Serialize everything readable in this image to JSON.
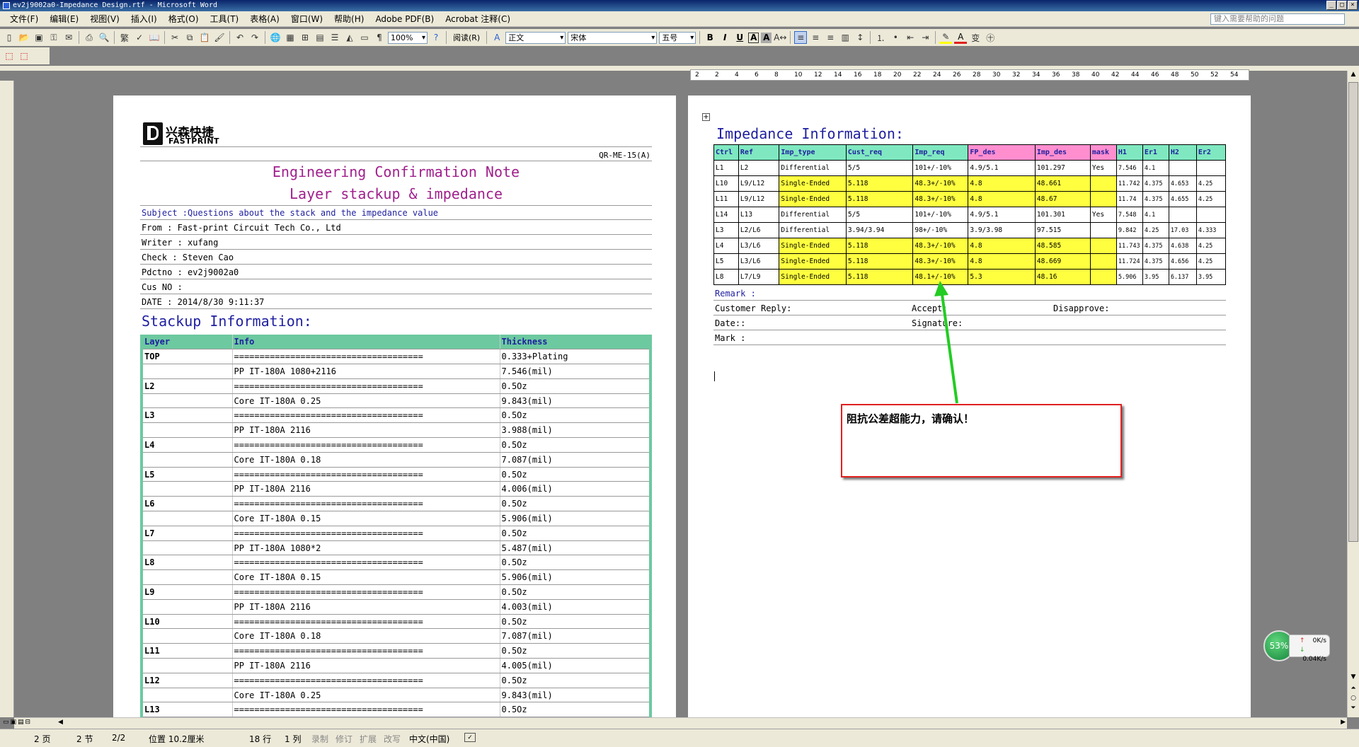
{
  "window": {
    "title": "ev2j9002a0-Impedance Design.rtf - Microsoft Word"
  },
  "menu": [
    "文件(F)",
    "编辑(E)",
    "视图(V)",
    "插入(I)",
    "格式(O)",
    "工具(T)",
    "表格(A)",
    "窗口(W)",
    "帮助(H)",
    "Adobe PDF(B)",
    "Acrobat 注释(C)"
  ],
  "help_placeholder": "键入需要帮助的问题",
  "toolbar": {
    "zoom": "100%",
    "read_label": "阅读(R)",
    "style": "正文",
    "font": "宋体",
    "size": "五号"
  },
  "ruler_ticks": [
    "2",
    "2",
    "4",
    "6",
    "8",
    "10",
    "12",
    "14",
    "16",
    "18",
    "20",
    "22",
    "24",
    "26",
    "28",
    "30",
    "32",
    "34",
    "36",
    "38",
    "40",
    "42",
    "44",
    "46",
    "48",
    "50",
    "52",
    "54"
  ],
  "page1": {
    "logo_cn": "兴森快捷",
    "logo_en": "FASTPRINT",
    "doc_code": "QR-ME-15(A)",
    "title1": "Engineering Confirmation Note",
    "title2": "Layer stackup & impedance",
    "subject": "Subject :Questions about the stack and the impedance value",
    "from": "From    : Fast-print Circuit Tech Co., Ltd",
    "writer": "Writer  : xufang",
    "check": "Check   : Steven Cao",
    "pdctno": "Pdctno  : ev2j9002a0",
    "cusno": "Cus NO  : ",
    "date": "DATE    : 2014/8/30 9:11:37",
    "stackup_heading": "Stackup Information:",
    "stack_headers": [
      "Layer",
      "Info",
      "Thickness"
    ],
    "stack_rows": [
      [
        "TOP",
        "=====================================",
        "0.333+Plating"
      ],
      [
        "",
        "PP    IT-180A    1080+2116",
        "7.546(mil)"
      ],
      [
        "L2",
        "=====================================",
        "0.5Oz"
      ],
      [
        "",
        "Core     IT-180A    0.25",
        "9.843(mil)"
      ],
      [
        "L3",
        "=====================================",
        "0.5Oz"
      ],
      [
        "",
        "PP    IT-180A    2116",
        "3.988(mil)"
      ],
      [
        "L4",
        "=====================================",
        "0.5Oz"
      ],
      [
        "",
        "Core     IT-180A    0.18",
        "7.087(mil)"
      ],
      [
        "L5",
        "=====================================",
        "0.5Oz"
      ],
      [
        "",
        "PP    IT-180A    2116",
        "4.006(mil)"
      ],
      [
        "L6",
        "=====================================",
        "0.5Oz"
      ],
      [
        "",
        "Core     IT-180A    0.15",
        "5.906(mil)"
      ],
      [
        "L7",
        "=====================================",
        "0.5Oz"
      ],
      [
        "",
        "PP    IT-180A    1080*2",
        "5.487(mil)"
      ],
      [
        "L8",
        "=====================================",
        "0.5Oz"
      ],
      [
        "",
        "Core     IT-180A    0.15",
        "5.906(mil)"
      ],
      [
        "L9",
        "=====================================",
        "0.5Oz"
      ],
      [
        "",
        "PP    IT-180A    2116",
        "4.003(mil)"
      ],
      [
        "L10",
        "=====================================",
        "0.5Oz"
      ],
      [
        "",
        "Core     IT-180A    0.18",
        "7.087(mil)"
      ],
      [
        "L11",
        "=====================================",
        "0.5Oz"
      ],
      [
        "",
        "PP    IT-180A    2116",
        "4.005(mil)"
      ],
      [
        "L12",
        "=====================================",
        "0.5Oz"
      ],
      [
        "",
        "Core     IT-180A    0.25",
        "9.843(mil)"
      ],
      [
        "L13",
        "=====================================",
        "0.5Oz"
      ]
    ]
  },
  "page2": {
    "impedance_heading": "Impedance Information:",
    "imp_headers": [
      "Ctrl",
      "Ref",
      "Imp_type",
      "Cust_req",
      "Imp_req",
      "FP_des",
      "Imp_des",
      "mask",
      "H1",
      "Er1",
      "H2",
      "Er2"
    ],
    "imp_rows": [
      {
        "cells": [
          "L1",
          "L2",
          "Differential",
          "5/5",
          "101+/-10%",
          "4.9/5.1",
          "101.297",
          "Yes",
          "7.546",
          "4.1",
          "",
          ""
        ],
        "highlight": false
      },
      {
        "cells": [
          "L10",
          "L9/L12",
          "Single-Ended",
          "5.118",
          "48.3+/-10%",
          "4.8",
          "48.661",
          "",
          "11.742",
          "4.375",
          "4.653",
          "4.25"
        ],
        "highlight": true
      },
      {
        "cells": [
          "L11",
          "L9/L12",
          "Single-Ended",
          "5.118",
          "48.3+/-10%",
          "4.8",
          "48.67",
          "",
          "11.74",
          "4.375",
          "4.655",
          "4.25"
        ],
        "highlight": true
      },
      {
        "cells": [
          "L14",
          "L13",
          "Differential",
          "5/5",
          "101+/-10%",
          "4.9/5.1",
          "101.301",
          "Yes",
          "7.548",
          "4.1",
          "",
          ""
        ],
        "highlight": false
      },
      {
        "cells": [
          "L3",
          "L2/L6",
          "Differential",
          "3.94/3.94",
          "98+/-10%",
          "3.9/3.98",
          "97.515",
          "",
          "9.842",
          "4.25",
          "17.03",
          "4.333"
        ],
        "highlight": false
      },
      {
        "cells": [
          "L4",
          "L3/L6",
          "Single-Ended",
          "5.118",
          "48.3+/-10%",
          "4.8",
          "48.585",
          "",
          "11.743",
          "4.375",
          "4.638",
          "4.25"
        ],
        "highlight": true
      },
      {
        "cells": [
          "L5",
          "L3/L6",
          "Single-Ended",
          "5.118",
          "48.3+/-10%",
          "4.8",
          "48.669",
          "",
          "11.724",
          "4.375",
          "4.656",
          "4.25"
        ],
        "highlight": true
      },
      {
        "cells": [
          "L8",
          "L7/L9",
          "Single-Ended",
          "5.118",
          "48.1+/-10%",
          "5.3",
          "48.16",
          "",
          "5.906",
          "3.95",
          "6.137",
          "3.95"
        ],
        "highlight": true
      }
    ],
    "remark": "Remark :",
    "customer_reply": "Customer Reply:",
    "accept": "Accept:",
    "disapprove": "Disapprove:",
    "date_label": "Date::",
    "signature": "Signature:",
    "mark": "Mark :"
  },
  "callout": {
    "text": "阻抗公差超能力，请确认！",
    "border_color": "#e02020",
    "arrow_color": "#22cc22"
  },
  "net_widget": {
    "percent": "53%",
    "up": "0K/s",
    "down": "0.04K/s"
  },
  "status": {
    "page": "2 页",
    "section": "2 节",
    "pages": "2/2",
    "position": "位置 10.2厘米",
    "line": "18 行",
    "col": "1 列",
    "rec": "录制",
    "rev": "修订",
    "ext": "扩展",
    "ovr": "改写",
    "lang": "中文(中国)"
  }
}
